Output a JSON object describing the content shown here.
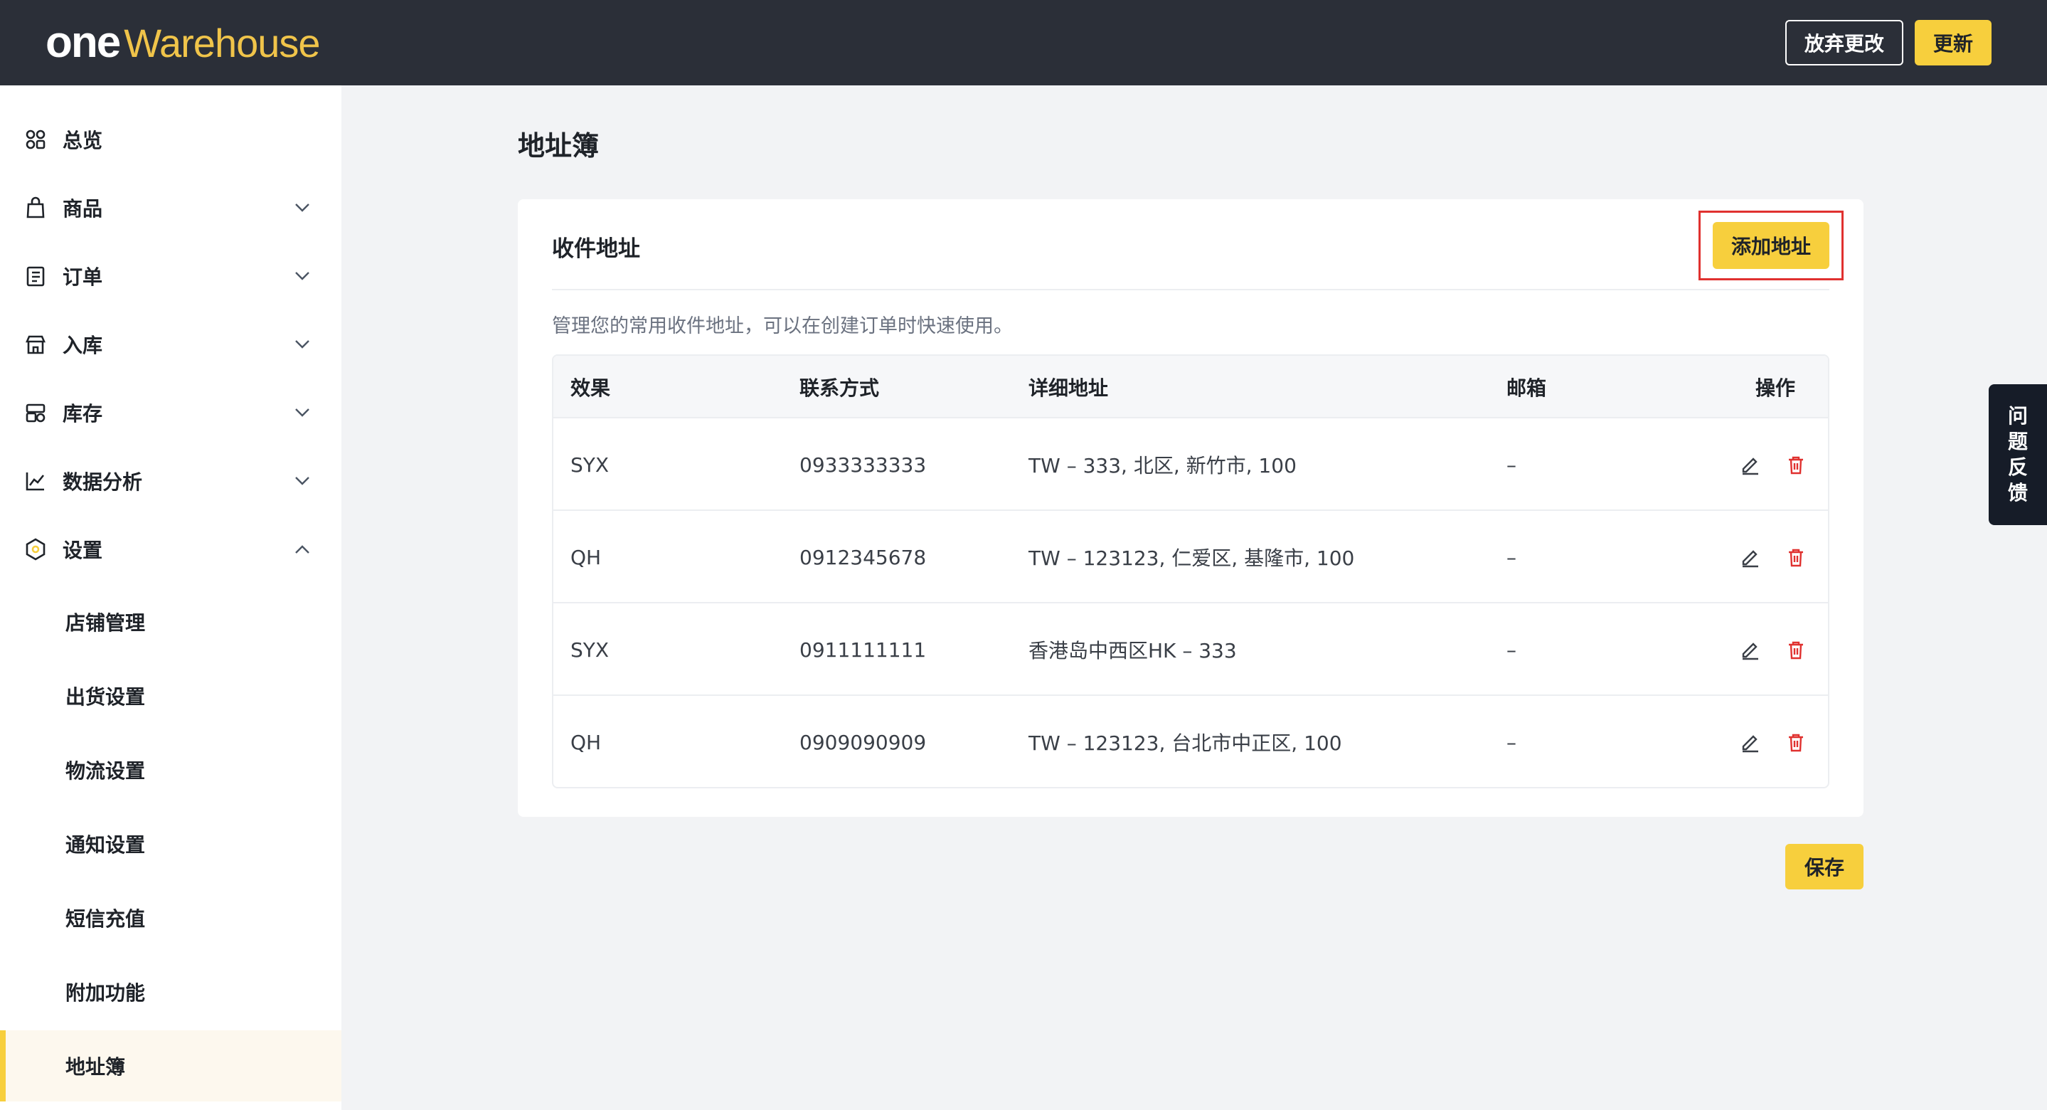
{
  "header": {
    "logo_one": "one",
    "logo_warehouse": "Warehouse",
    "discard_label": "放弃更改",
    "update_label": "更新"
  },
  "sidebar": {
    "items": [
      {
        "label": "总览",
        "icon": "grid-icon",
        "expandable": false
      },
      {
        "label": "商品",
        "icon": "shopping-bag-icon",
        "expandable": true
      },
      {
        "label": "订单",
        "icon": "order-list-icon",
        "expandable": true
      },
      {
        "label": "入库",
        "icon": "storefront-icon",
        "expandable": true
      },
      {
        "label": "库存",
        "icon": "inventory-icon",
        "expandable": true
      },
      {
        "label": "数据分析",
        "icon": "chart-icon",
        "expandable": true
      },
      {
        "label": "设置",
        "icon": "settings-hexagon-icon",
        "expandable": true,
        "expanded": true
      }
    ],
    "sub_items": [
      {
        "label": "店铺管理"
      },
      {
        "label": "出货设置"
      },
      {
        "label": "物流设置"
      },
      {
        "label": "通知设置"
      },
      {
        "label": "短信充值"
      },
      {
        "label": "附加功能"
      },
      {
        "label": "地址簿",
        "active": true
      }
    ]
  },
  "main": {
    "page_title": "地址簿",
    "card": {
      "title": "收件地址",
      "add_button": "添加地址",
      "description": "管理您的常用收件地址，可以在创建订单时快速使用。",
      "columns": [
        "效果",
        "联系方式",
        "详细地址",
        "邮箱",
        "操作"
      ],
      "rows": [
        {
          "name": "SYX",
          "phone": "0933333333",
          "address": "TW – 333, 北区, 新竹市, 100",
          "email": "–"
        },
        {
          "name": "QH",
          "phone": "0912345678",
          "address": "TW – 123123, 仁爱区, 基隆市, 100",
          "email": "–"
        },
        {
          "name": "SYX",
          "phone": "0911111111",
          "address": "香港岛中西区HK – 333",
          "email": "–"
        },
        {
          "name": "QH",
          "phone": "0909090909",
          "address": "TW – 123123, 台北市中正区, 100",
          "email": "–"
        }
      ]
    },
    "save_label": "保存"
  },
  "feedback": {
    "label": "问题反馈"
  },
  "colors": {
    "accent": "#f7cf3d",
    "header_bg": "#2b2f38",
    "delete_red": "#e0312f",
    "highlight_border": "#e0312f"
  }
}
